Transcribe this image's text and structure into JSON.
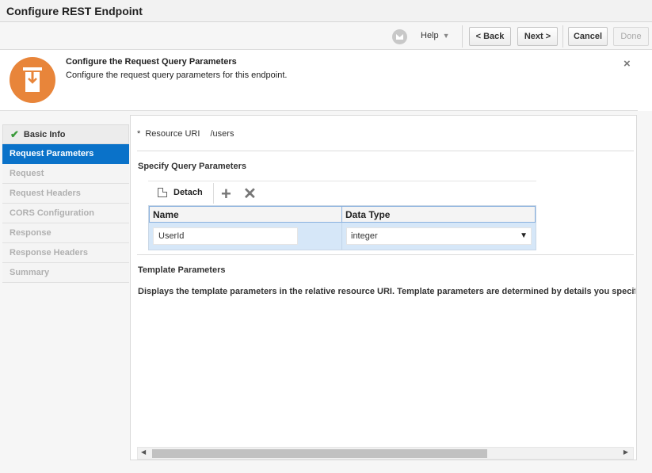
{
  "window": {
    "title": "Configure REST Endpoint"
  },
  "toolbar": {
    "help_label": "Help",
    "back_label": "< Back",
    "next_label": "Next >",
    "cancel_label": "Cancel",
    "done_label": "Done"
  },
  "banner": {
    "title": "Configure the Request Query Parameters",
    "description": "Configure the request query parameters for this endpoint.",
    "close_glyph": "×"
  },
  "nav": {
    "items": [
      {
        "label": "Basic Info",
        "state": "done"
      },
      {
        "label": "Request Parameters",
        "state": "active"
      },
      {
        "label": "Request",
        "state": "disabled"
      },
      {
        "label": "Request Headers",
        "state": "disabled"
      },
      {
        "label": "CORS Configuration",
        "state": "disabled"
      },
      {
        "label": "Response",
        "state": "disabled"
      },
      {
        "label": "Response Headers",
        "state": "disabled"
      },
      {
        "label": "Summary",
        "state": "disabled"
      }
    ]
  },
  "main": {
    "resource_uri_required": "*",
    "resource_uri_label": "Resource URI",
    "resource_uri_value": "/users",
    "query_section_title": "Specify Query Parameters",
    "table_toolbar": {
      "detach_label": "Detach",
      "add_glyph": "+",
      "delete_glyph": "✕"
    },
    "table": {
      "columns": [
        "Name",
        "Data Type"
      ],
      "rows": [
        {
          "name": "UserId",
          "data_type": "integer"
        }
      ]
    },
    "template_section_title": "Template Parameters",
    "template_description": "Displays the template parameters in the relative resource URI. Template parameters are determined by details you specifie"
  },
  "colors": {
    "accent": "#0a72c9",
    "banner_icon": "#e8853a",
    "check": "#3a9a3a"
  }
}
